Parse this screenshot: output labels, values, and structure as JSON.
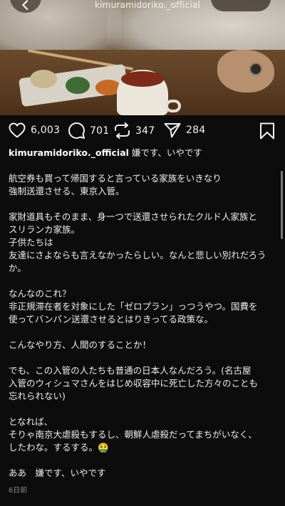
{
  "header": {
    "username": "kimuramidoriko._official"
  },
  "actions": {
    "likes": "6,003",
    "comments": "701",
    "reposts": "347",
    "shares": "284"
  },
  "caption": {
    "username": "kimuramidoriko._official",
    "lead": "嫌です、いやです",
    "paragraphs": [
      "航空券も買って帰国すると言っている家族をいきなり\n強制送還させる、東京入管。",
      "家財道具もそのまま、身一つで送還させられたクルド人家族と\nスリランカ家族。\n子供たちは\n友達にさよならも言えなかったらしい。なんと悲しい別れだろうか。",
      "なんなのこれ？\n非正規滞在者を対象にした「ゼロプラン」っつうやつ。国費を\n使ってバンバン送還させるとはりきってる政策な。",
      "こんなやり方、人間のすることか！",
      "でも、この入管の人たちも普通の日本人なんだろう。(名古屋\n入管のウィシュマさんをはじめ収容中に死亡した方々のことも\n忘れられない)",
      "となれば、\nそりゃ南京大虐殺もするし、朝鮮人虐殺だってまちがいなく、\nしたわな。するする。🤮",
      "ああ　嫌です、いやです"
    ]
  },
  "timestamp": "6日前",
  "icons": {
    "back": "chevron-left-icon",
    "like": "heart-icon",
    "comment": "comment-bubble-icon",
    "repost": "repost-icon",
    "share": "send-icon",
    "save": "bookmark-icon"
  }
}
